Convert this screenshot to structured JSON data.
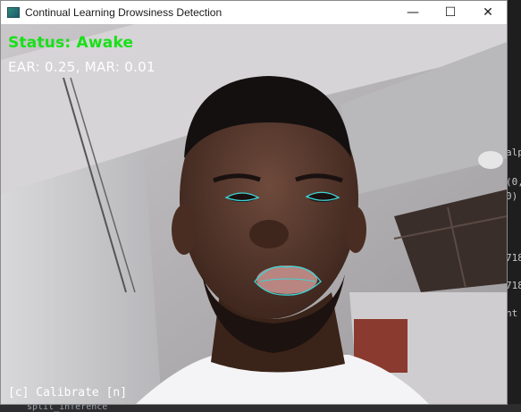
{
  "window": {
    "title": "Continual Learning Drowsiness Detection",
    "app_icon": "camera-icon",
    "controls": {
      "minimize": "—",
      "maximize": "☐",
      "close": "✕"
    }
  },
  "overlay": {
    "status_text": "Status: Awake",
    "status_color": "#18e018",
    "metrics_text": "EAR: 0.25, MAR: 0.01",
    "help_text": "[c] Calibrate  [n]"
  },
  "background_app": {
    "code_fragments": [
      "alp",
      "(0,",
      "0)",
      "718",
      "718",
      "nt"
    ],
    "bottom_item": "split_inference"
  },
  "colors": {
    "landmark_outline": "#3dd6d6"
  }
}
